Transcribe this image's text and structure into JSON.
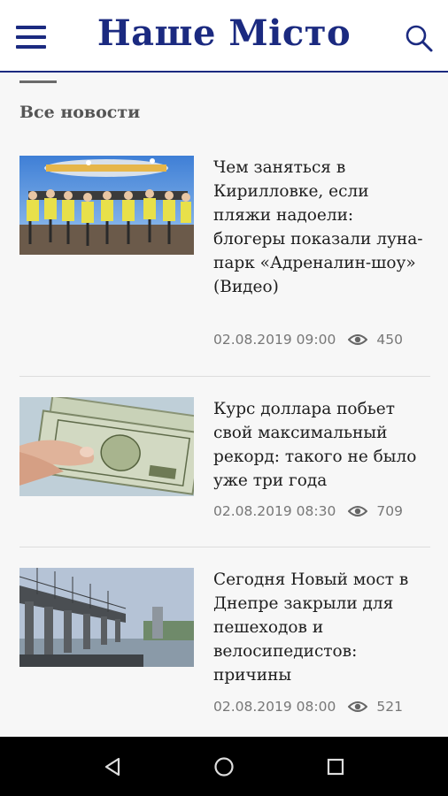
{
  "header": {
    "logo_text": "Наше Місто",
    "menu_icon": "hamburger-menu-icon",
    "search_icon": "search-icon",
    "brand_color": "#1b2a80"
  },
  "section": {
    "title": "Все новости"
  },
  "articles": [
    {
      "headline": "Чем заняться в Кирилловке, если пляжи надоели: блогеры показали луна-парк «Адреналин-шоу» (Видео)",
      "date": "02.08.2019 09:00",
      "views": "450"
    },
    {
      "headline": "Курс доллара побьет свой максимальный рекорд: такого не было уже три года",
      "date": "02.08.2019 08:30",
      "views": "709"
    },
    {
      "headline": "Сегодня Новый мост в Днепре закрыли для пешеходов и велосипедистов: причины",
      "date": "02.08.2019 08:00",
      "views": "521"
    }
  ],
  "navbar": {
    "back_icon": "back-triangle-icon",
    "home_icon": "home-circle-icon",
    "recents_icon": "recents-square-icon"
  }
}
